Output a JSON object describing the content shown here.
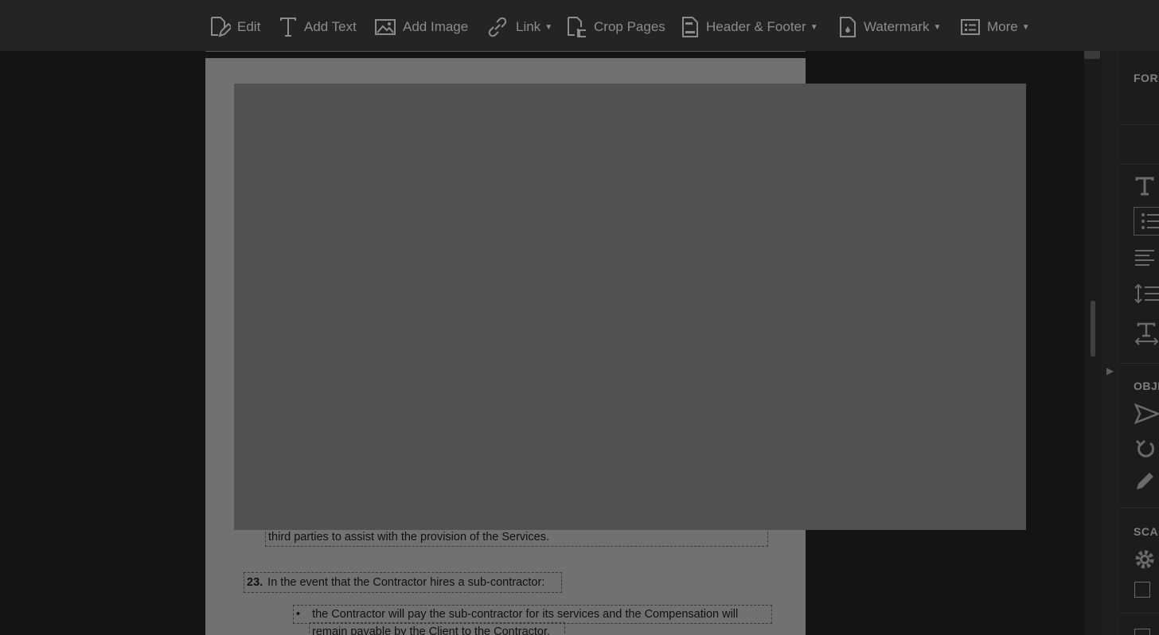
{
  "toolbar": {
    "edit_label": "Edit",
    "add_text_label": "Add Text",
    "add_image_label": "Add Image",
    "link_label": "Link",
    "crop_pages_label": "Crop Pages",
    "header_footer_label": "Header & Footer",
    "watermark_label": "Watermark",
    "more_label": "More"
  },
  "document": {
    "para22_tail": "third parties to assist with the provision of the Services.",
    "item23_number": "23.",
    "item23_text": "In the event that the Contractor hires a sub-contractor:",
    "bullet_char": "•",
    "bullet1_line1": "the Contractor will pay the sub-contractor for its services and the Compensation will",
    "bullet1_line2": "remain payable by the Client to the Contractor."
  },
  "right_panel": {
    "format_title": "FORMAT",
    "objects_title": "OBJECTS",
    "scan_title": "SCAN"
  },
  "colors": {
    "toolbar_bg": "#242424",
    "page_bg": "#717171",
    "overlay_bg": "#515151",
    "icon_gray": "#8c8c8c"
  }
}
